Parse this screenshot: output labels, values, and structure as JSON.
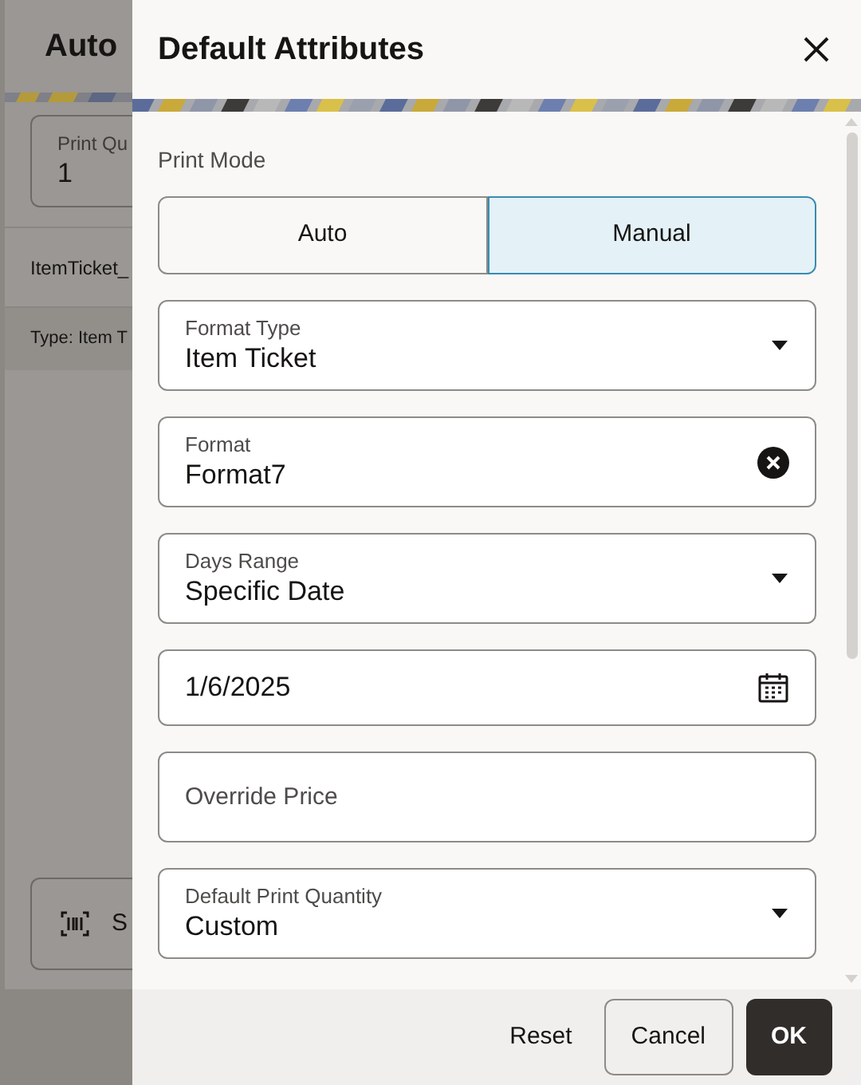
{
  "background": {
    "title": "Auto",
    "field": {
      "label": "Print Qu",
      "value": "1"
    },
    "row_text": "ItemTicket_",
    "row_subtext": "Type: Item T",
    "button": "S"
  },
  "drawer": {
    "title": "Default Attributes",
    "print_mode": {
      "label": "Print Mode",
      "options": [
        {
          "label": "Auto",
          "selected": false
        },
        {
          "label": "Manual",
          "selected": true
        }
      ]
    },
    "fields": [
      {
        "kind": "select",
        "label": "Format Type",
        "value": "Item Ticket"
      },
      {
        "kind": "clearable",
        "label": "Format",
        "value": "Format7"
      },
      {
        "kind": "select",
        "label": "Days Range",
        "value": "Specific Date"
      },
      {
        "kind": "date",
        "value": "1/6/2025"
      },
      {
        "kind": "text",
        "placeholder": "Override Price"
      },
      {
        "kind": "select",
        "label": "Default Print Quantity",
        "value": "Custom"
      }
    ],
    "buttons": [
      {
        "kind": "text",
        "label": "Reset"
      },
      {
        "kind": "outline",
        "label": "Cancel"
      },
      {
        "kind": "primary",
        "label": "OK"
      }
    ]
  }
}
